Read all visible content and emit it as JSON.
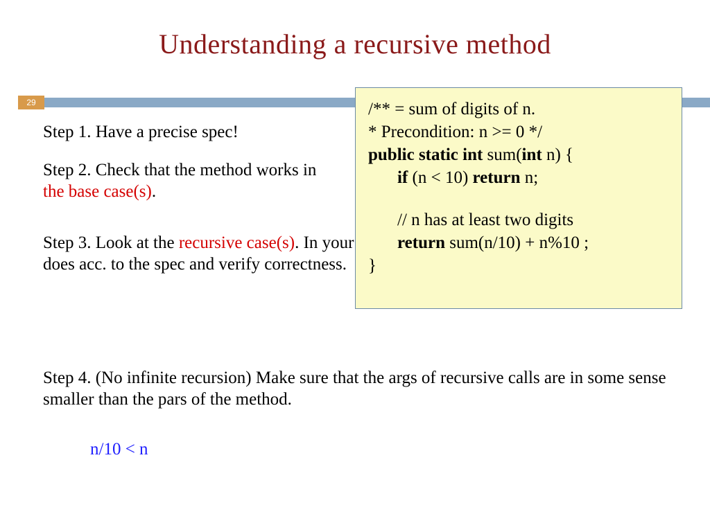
{
  "page_number": "29",
  "title": "Understanding a recursive method",
  "step1": "Step 1. Have a precise spec!",
  "step2": {
    "a": "Step 2. Check that the method works in ",
    "b": "the base case(s)",
    "c": "."
  },
  "step3": {
    "a": "Step 3. Look at the ",
    "b": "recursive case(s)",
    "c": ". In your mind replace each recursive call by what it does acc. to the spec and verify correctness."
  },
  "step4": "Step 4. (No infinite recursion) Make sure that the args of recursive calls are in some sense smaller than the pars of the method.",
  "note": "n/10  <  n",
  "code": {
    "c1a": "/** =  sum of digits of n.",
    "c2a": "   * Precondition:  n >= 0 */",
    "c3a": "public static int",
    "c3b": " sum(",
    "c3c": "int",
    "c3d": " n) {",
    "c4a": "if",
    "c4b": " (n < 10) ",
    "c4c": "return",
    "c4d": " n;",
    "c5": "// n has at least two digits",
    "c6a": "return",
    "c6b": " sum(n/10)  +  n%10 ;",
    "c7": "}"
  }
}
